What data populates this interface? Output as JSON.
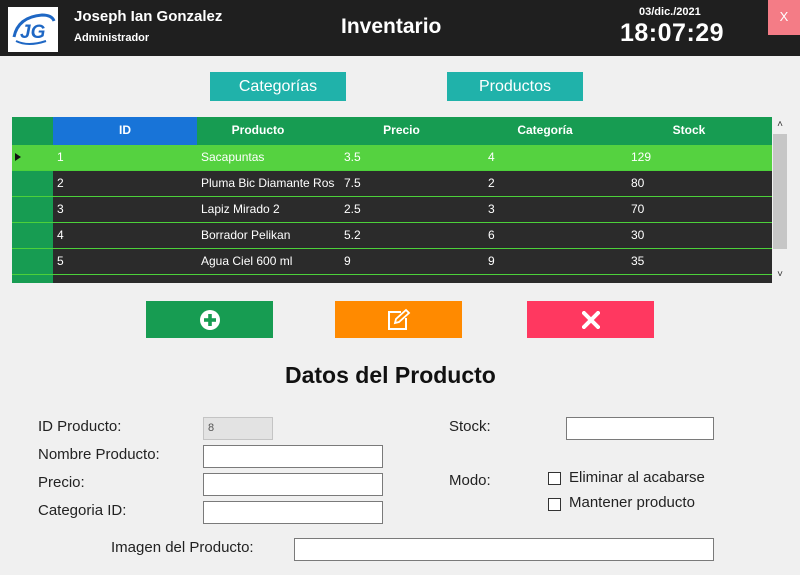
{
  "header": {
    "user_name": "Joseph Ian Gonzalez",
    "user_role": "Administrador",
    "title": "Inventario",
    "date": "03/dic./2021",
    "time": "18:07:29",
    "close_label": "X",
    "logo_icon": "jg-logo-icon"
  },
  "nav": {
    "categorias": "Categorías",
    "productos": "Productos"
  },
  "grid": {
    "columns": [
      "ID",
      "Producto",
      "Precio",
      "Categoría",
      "Stock"
    ],
    "rows": [
      {
        "id": "1",
        "producto": "Sacapuntas",
        "precio": "3.5",
        "categoria": "4",
        "stock": "129",
        "selected": true
      },
      {
        "id": "2",
        "producto": "Pluma Bic Diamante Rosa",
        "precio": "7.5",
        "categoria": "2",
        "stock": "80"
      },
      {
        "id": "3",
        "producto": "Lapiz Mirado 2",
        "precio": "2.5",
        "categoria": "3",
        "stock": "70"
      },
      {
        "id": "4",
        "producto": "Borrador Pelikan",
        "precio": "5.2",
        "categoria": "6",
        "stock": "30"
      },
      {
        "id": "5",
        "producto": "Agua Ciel 600 ml",
        "precio": "9",
        "categoria": "9",
        "stock": "35"
      }
    ]
  },
  "actions": {
    "add_icon": "plus-circle-icon",
    "edit_icon": "edit-icon",
    "delete_icon": "close-icon",
    "colors": {
      "add": "#179c52",
      "edit": "#ff8a00",
      "delete": "#ff3860"
    }
  },
  "form": {
    "title": "Datos del Producto",
    "id_label": "ID Producto:",
    "id_value": "8",
    "nombre_label": "Nombre Producto:",
    "precio_label": "Precio:",
    "categoria_label": "Categoria ID:",
    "stock_label": "Stock:",
    "modo_label": "Modo:",
    "modo_option1": "Eliminar al acabarse",
    "modo_option2": "Mantener producto",
    "imagen_label": "Imagen del Producto:"
  }
}
